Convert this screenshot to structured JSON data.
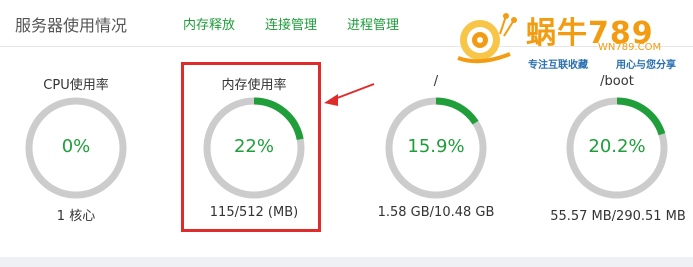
{
  "header": {
    "title": "服务器使用情况",
    "tabs": [
      {
        "label": "内存释放"
      },
      {
        "label": "连接管理"
      },
      {
        "label": "进程管理"
      }
    ]
  },
  "logo": {
    "brand": "蜗牛789",
    "domain": "WN789.COM",
    "slogan_left": "专注互联收藏",
    "slogan_right": "用心与您分享"
  },
  "gauges": [
    {
      "label": "CPU使用率",
      "percent_text": "0%",
      "fraction": 0.0,
      "detail": "1 核心"
    },
    {
      "label": "内存使用率",
      "percent_text": "22%",
      "fraction": 0.22,
      "detail": "115/512 (MB)"
    },
    {
      "label": "/",
      "percent_text": "15.9%",
      "fraction": 0.159,
      "detail": "1.58 GB/10.48 GB"
    },
    {
      "label": "/boot",
      "percent_text": "20.2%",
      "fraction": 0.202,
      "detail": "55.57 MB/290.51 MB"
    }
  ],
  "colors": {
    "accent": "#1f9e3a",
    "track": "#cccccc",
    "highlight": "#e02b2b",
    "logo_orange": "#f39c12"
  }
}
